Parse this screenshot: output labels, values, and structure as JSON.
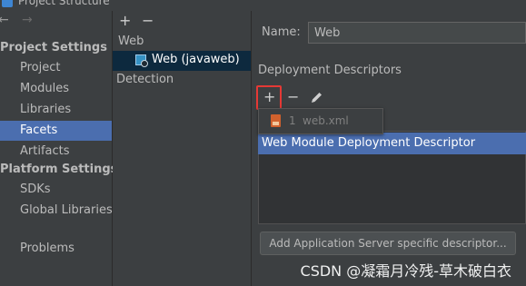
{
  "window": {
    "title": "Project Structure"
  },
  "nav": {
    "back_arrow": "←",
    "forward_arrow": "→",
    "project_settings_header": "Project Settings",
    "project_settings_items": [
      "Project",
      "Modules",
      "Libraries",
      "Facets",
      "Artifacts"
    ],
    "platform_settings_header": "Platform Settings",
    "platform_settings_items": [
      "SDKs",
      "Global Libraries"
    ],
    "problems_label": "Problems",
    "selected_item": "Facets"
  },
  "facets_tree": {
    "add_symbol": "+",
    "remove_symbol": "−",
    "group_label": "Web",
    "web_facet_label": "Web (javaweb)",
    "detection_label": "Detection"
  },
  "facet_detail": {
    "name_label": "Name:",
    "name_value": "Web",
    "deployment_descriptors_title": "Deployment Descriptors",
    "toolbar": {
      "add_symbol": "+",
      "remove_symbol": "−",
      "edit_icon": "pencil-icon"
    },
    "popup": {
      "item_number": "1",
      "item_label": "web.xml"
    },
    "descriptor_row": "Web Module Deployment Descriptor",
    "add_server_descriptor_button": "Add Application Server specific descriptor..."
  },
  "watermark": "CSDN @凝霜月冷残-草木破白衣",
  "colors": {
    "background": "#3c3f41",
    "selection": "#4b6eaf",
    "highlight_border": "#e53935",
    "xml_icon": "#d0612d"
  }
}
